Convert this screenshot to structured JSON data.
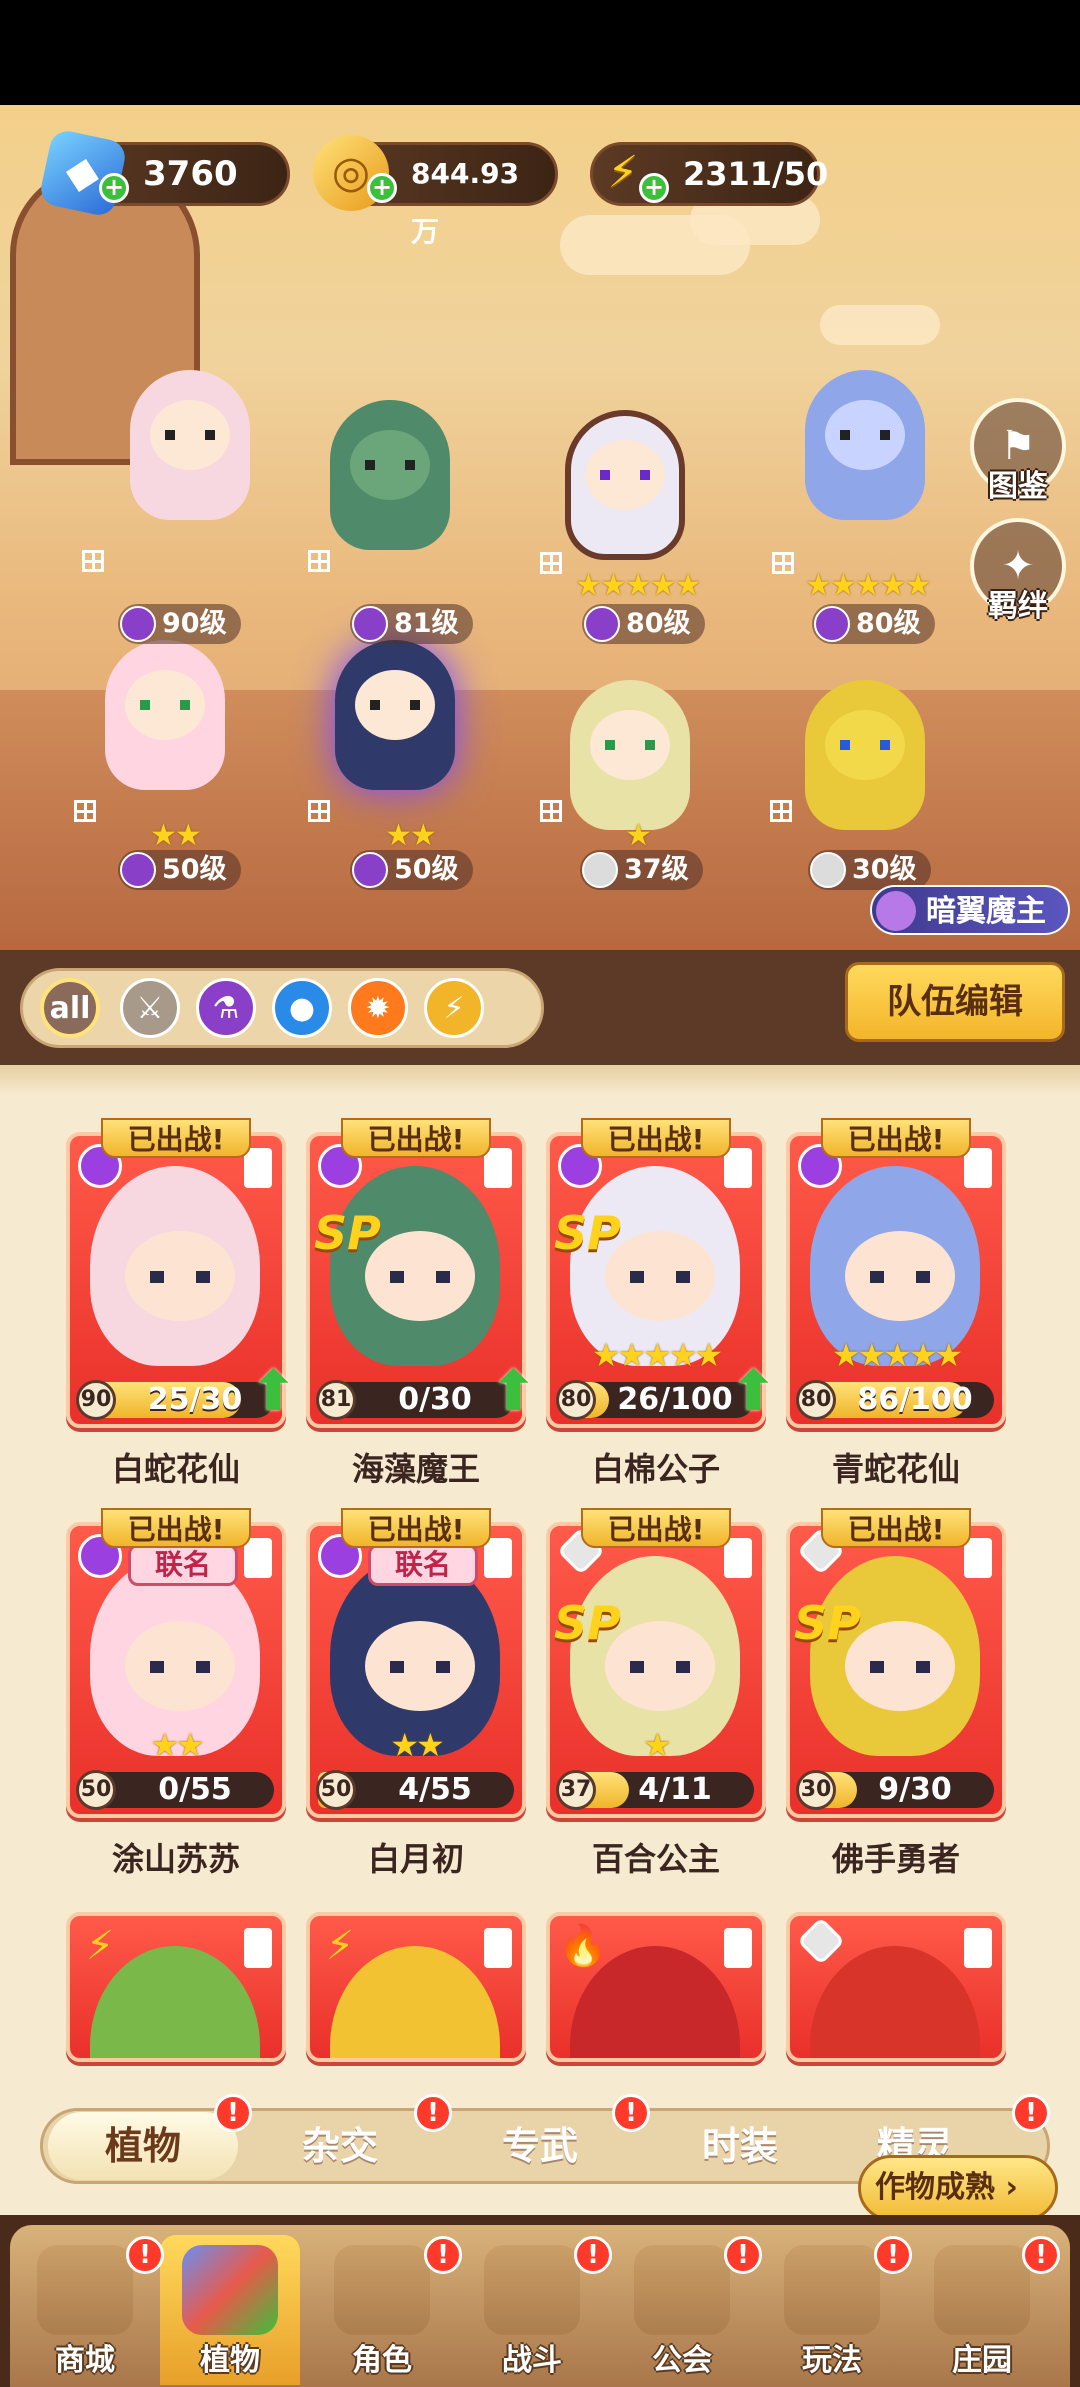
{
  "resources": {
    "gems": "3760",
    "gold": "844.93万",
    "energy": "2311/50"
  },
  "side_buttons": {
    "codex": "图鉴",
    "bond": "羁绊"
  },
  "team": [
    {
      "level": "90级",
      "stars": "",
      "element": "potion"
    },
    {
      "level": "81级",
      "stars": "",
      "element": "potion"
    },
    {
      "level": "80级",
      "stars": "★★★★★",
      "element": "potion"
    },
    {
      "level": "80级",
      "stars": "★★★★★",
      "element": "potion"
    },
    {
      "level": "50级",
      "stars": "★★",
      "element": "potion"
    },
    {
      "level": "50级",
      "stars": "★★",
      "element": "potion"
    },
    {
      "level": "37级",
      "stars": "★",
      "element": "sword"
    },
    {
      "level": "30级",
      "stars": "",
      "element": "sword"
    }
  ],
  "boss_label": "暗翼魔主",
  "filters": {
    "all": "all",
    "icons": [
      "sword-icon",
      "potion-icon",
      "water-icon",
      "fire-icon",
      "bolt-icon"
    ]
  },
  "edit_team": "队伍编辑",
  "deployed_tag": "已出战!",
  "coop_tag": "联名",
  "sp_tag": "SP",
  "cards": [
    {
      "name": "白蛇花仙",
      "level": "90",
      "progress": "25/30",
      "fill": 0.83,
      "stars": "",
      "elem": "potion",
      "sp": false,
      "coop": false,
      "upgrade": true,
      "color": "#f7d8e0"
    },
    {
      "name": "海藻魔王",
      "level": "81",
      "progress": "0/30",
      "fill": 0.0,
      "stars": "",
      "elem": "potion",
      "sp": true,
      "coop": false,
      "upgrade": true,
      "color": "#4f8a6a"
    },
    {
      "name": "白棉公子",
      "level": "80",
      "progress": "26/100",
      "fill": 0.26,
      "stars": "★★★★★",
      "elem": "potion",
      "sp": true,
      "coop": false,
      "upgrade": true,
      "color": "#ece9f5"
    },
    {
      "name": "青蛇花仙",
      "level": "80",
      "progress": "86/100",
      "fill": 0.86,
      "stars": "★★★★★",
      "elem": "potion",
      "sp": false,
      "coop": false,
      "upgrade": false,
      "color": "#8fa6e8"
    },
    {
      "name": "涂山苏苏",
      "level": "50",
      "progress": "0/55",
      "fill": 0.0,
      "stars": "★★",
      "elem": "potion",
      "sp": false,
      "coop": true,
      "upgrade": false,
      "color": "#ffd5e2"
    },
    {
      "name": "白月初",
      "level": "50",
      "progress": "4/55",
      "fill": 0.07,
      "stars": "★★",
      "elem": "potion",
      "sp": false,
      "coop": true,
      "upgrade": false,
      "color": "#2f3a6a"
    },
    {
      "name": "百合公主",
      "level": "37",
      "progress": "4/11",
      "fill": 0.36,
      "stars": "★",
      "elem": "sword",
      "sp": true,
      "coop": false,
      "upgrade": false,
      "color": "#e9e2a6"
    },
    {
      "name": "佛手勇者",
      "level": "30",
      "progress": "9/30",
      "fill": 0.3,
      "stars": "",
      "elem": "sword",
      "sp": true,
      "coop": false,
      "upgrade": false,
      "color": "#e9c83a"
    }
  ],
  "partial_cards": [
    {
      "elem": "bolt",
      "color": "#7ab84a"
    },
    {
      "elem": "bolt",
      "color": "#f2c232"
    },
    {
      "elem": "fire",
      "color": "#c8282a"
    },
    {
      "elem": "sword",
      "color": "#d8342a"
    }
  ],
  "category_tabs": [
    "植物",
    "杂交",
    "专武",
    "时装",
    "精灵"
  ],
  "crop_button": "作物成熟",
  "bottom_nav": [
    "商城",
    "植物",
    "角色",
    "战斗",
    "公会",
    "玩法",
    "庄园"
  ],
  "alert": "!"
}
